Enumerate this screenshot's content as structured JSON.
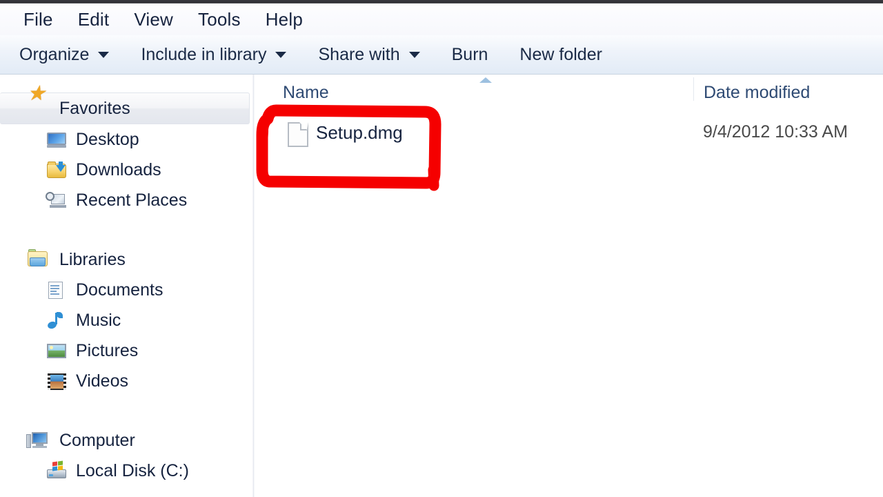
{
  "window": {
    "app": "Windows Explorer"
  },
  "menubar": {
    "items": [
      {
        "label": "File",
        "name": "menu-file"
      },
      {
        "label": "Edit",
        "name": "menu-edit"
      },
      {
        "label": "View",
        "name": "menu-view"
      },
      {
        "label": "Tools",
        "name": "menu-tools"
      },
      {
        "label": "Help",
        "name": "menu-help"
      }
    ]
  },
  "toolbar": {
    "items": [
      {
        "label": "Organize",
        "caret": true
      },
      {
        "label": "Include in library",
        "caret": true
      },
      {
        "label": "Share with",
        "caret": true
      },
      {
        "label": "Burn",
        "caret": false
      },
      {
        "label": "New folder",
        "caret": false
      }
    ]
  },
  "navpane": {
    "groups": [
      {
        "header": {
          "label": "Favorites",
          "icon": "star-icon",
          "selected": true
        },
        "children": [
          {
            "label": "Desktop",
            "icon": "desktop-icon"
          },
          {
            "label": "Downloads",
            "icon": "downloads-folder-icon"
          },
          {
            "label": "Recent Places",
            "icon": "recent-places-icon"
          }
        ]
      },
      {
        "header": {
          "label": "Libraries",
          "icon": "libraries-icon",
          "selected": false
        },
        "children": [
          {
            "label": "Documents",
            "icon": "documents-icon"
          },
          {
            "label": "Music",
            "icon": "music-note-icon"
          },
          {
            "label": "Pictures",
            "icon": "pictures-icon"
          },
          {
            "label": "Videos",
            "icon": "videos-icon"
          }
        ]
      },
      {
        "header": {
          "label": "Computer",
          "icon": "computer-icon",
          "selected": false
        },
        "children": [
          {
            "label": "Local Disk (C:)",
            "icon": "hard-disk-icon"
          }
        ]
      }
    ]
  },
  "filelist": {
    "columns": [
      {
        "label": "Name",
        "sorted": true,
        "sort_direction": "ascending"
      },
      {
        "label": "Date modified",
        "sorted": false,
        "sort_direction": ""
      }
    ],
    "rows": [
      {
        "name": "Setup.dmg",
        "date_modified": "9/4/2012 10:33 AM",
        "icon": "generic-file-icon",
        "annotated": true
      }
    ]
  },
  "annotation": {
    "shape": "rectangle",
    "color": "#f50000",
    "stroke_width": 16,
    "target": "Setup.dmg"
  },
  "colors": {
    "menubar_bg": "#fbfcfe",
    "toolbar_bg": "#e8effa",
    "text_primary": "#16233f",
    "column_header_text": "#2e4a73",
    "annotation_red": "#f50000",
    "pane_bg": "#ffffff"
  }
}
